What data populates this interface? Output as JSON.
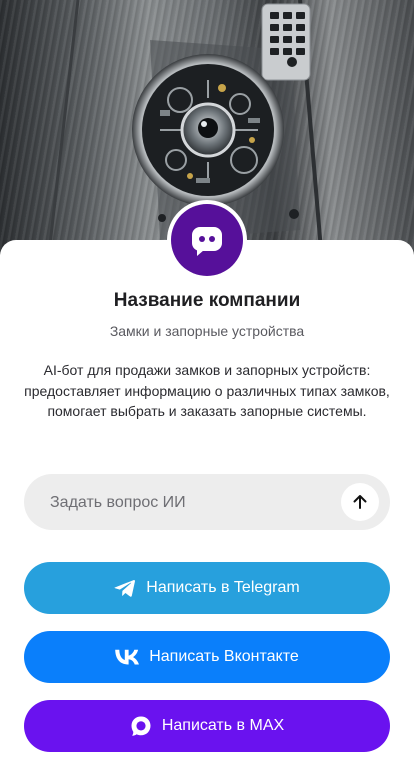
{
  "company": {
    "name": "Название компании",
    "subtitle": "Замки и запорные устройства",
    "description": "AI-бот для продажи замков и запорных устройств: предоставляет информацию о различных типах замков, помогает выбрать и заказать запорные системы."
  },
  "ask": {
    "placeholder": "Задать вопрос ИИ",
    "value": ""
  },
  "buttons": {
    "telegram": "Написать в Telegram",
    "vk": "Написать Вконтакте",
    "max": "Написать в MAX"
  },
  "icons": {
    "avatar": "bot-face-icon",
    "send": "arrow-up-icon",
    "telegram": "telegram-icon",
    "vk": "vk-icon",
    "max": "max-icon"
  },
  "colors": {
    "avatar": "#56109a",
    "telegram": "#27a0dd",
    "vk": "#0a7ffb",
    "max": "#6a12ef",
    "input_bg": "#ededed"
  }
}
